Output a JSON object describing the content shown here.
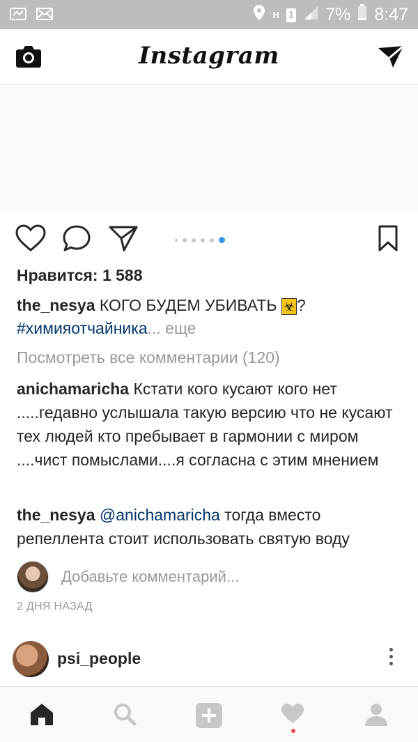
{
  "status_bar": {
    "battery": "7%",
    "time": "8:47",
    "sim": "1",
    "network": "H"
  },
  "header": {
    "logo": "Instagram"
  },
  "post": {
    "likes": "Нравится: 1 588",
    "caption": {
      "user": "the_nesya",
      "text": " КОГО БУДЕМ УБИВАТЬ ",
      "emoji": "☣",
      "suffix": "?",
      "hashtag": "#химияотчайника",
      "more": "... еще"
    },
    "view_all": "Посмотреть все комментарии (120)",
    "comments": [
      {
        "user": "anichamaricha",
        "text": " Кстати кого кусают кого нет .....гедавно услышала такую версию что не кусают тех людей кто пребывает в гармонии с миром ....чист помыслами....я согласна с этим мнением"
      },
      {
        "user": "the_nesya",
        "mention": "@anichamaricha",
        "text": " тогда вместо репеллента стоит использовать святую воду"
      }
    ],
    "add_comment_placeholder": "Добавьте комментарий...",
    "time": "2 ДНЯ НАЗАД"
  },
  "next_post": {
    "user": "psi_people"
  },
  "colors": {
    "link": "#003569",
    "muted": "#999999",
    "active_dot": "#3897f0",
    "notification": "#ed4956"
  }
}
